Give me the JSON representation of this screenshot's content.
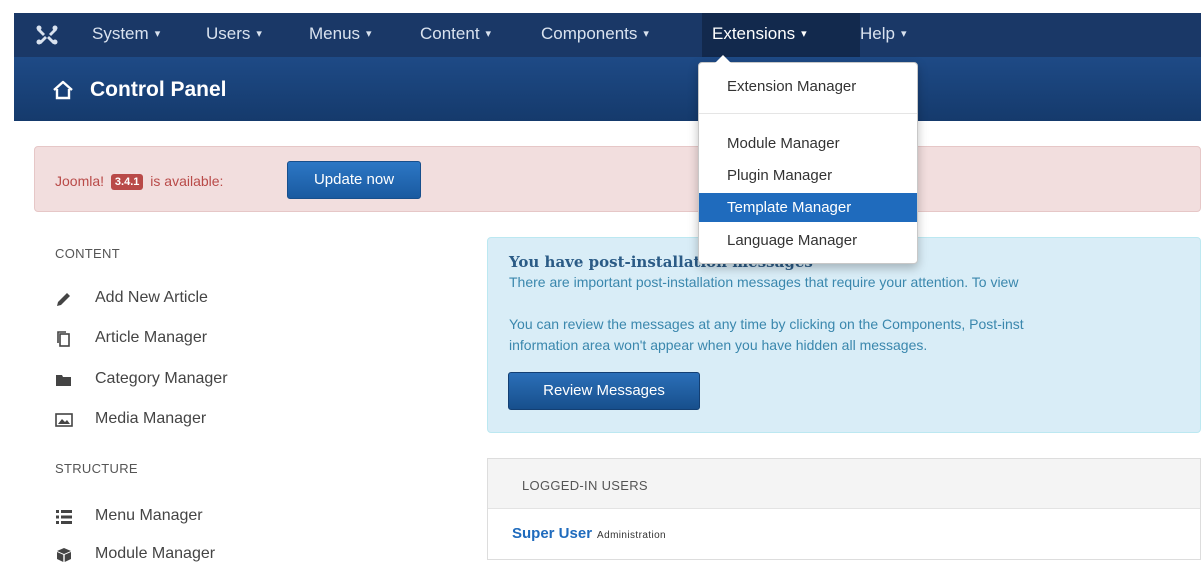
{
  "navbar": {
    "items": [
      {
        "label": "System"
      },
      {
        "label": "Users"
      },
      {
        "label": "Menus"
      },
      {
        "label": "Content"
      },
      {
        "label": "Components"
      },
      {
        "label": "Extensions"
      },
      {
        "label": "Help"
      }
    ],
    "caret": "▾"
  },
  "header": {
    "title": "Control Panel"
  },
  "alert": {
    "prefix": "Joomla!",
    "version": "3.4.1",
    "suffix": "is available:",
    "button": "Update now"
  },
  "sidebar": {
    "content_heading": "CONTENT",
    "content_items": [
      {
        "label": "Add New Article",
        "icon": "pencil-icon"
      },
      {
        "label": "Article Manager",
        "icon": "copy-icon"
      },
      {
        "label": "Category Manager",
        "icon": "folder-icon"
      },
      {
        "label": "Media Manager",
        "icon": "image-icon"
      }
    ],
    "structure_heading": "STRUCTURE",
    "structure_items": [
      {
        "label": "Menu Manager",
        "icon": "list-icon"
      },
      {
        "label": "Module Manager",
        "icon": "cube-icon"
      }
    ]
  },
  "messages": {
    "heading": "You have post-installation messages",
    "line1": "There are important post-installation messages that require your attention. To view",
    "line2": "You can review the messages at any time by clicking on the Components, Post-inst",
    "line3": "information area won't appear when you have hidden all messages.",
    "button": "Review Messages"
  },
  "logged_in": {
    "heading": "LOGGED-IN USERS",
    "user": "Super User",
    "role": "Administration"
  },
  "dropdown": {
    "items": [
      {
        "label": "Extension Manager"
      },
      {
        "label": "Module Manager"
      },
      {
        "label": "Plugin Manager"
      },
      {
        "label": "Template Manager"
      },
      {
        "label": "Language Manager"
      }
    ],
    "active_index": 3
  },
  "colors": {
    "navbar": "#1a3867",
    "header": "#1e4a86",
    "accent": "#1f6bbd",
    "alert_bg": "#f2dede",
    "info_bg": "#d9edf7"
  }
}
